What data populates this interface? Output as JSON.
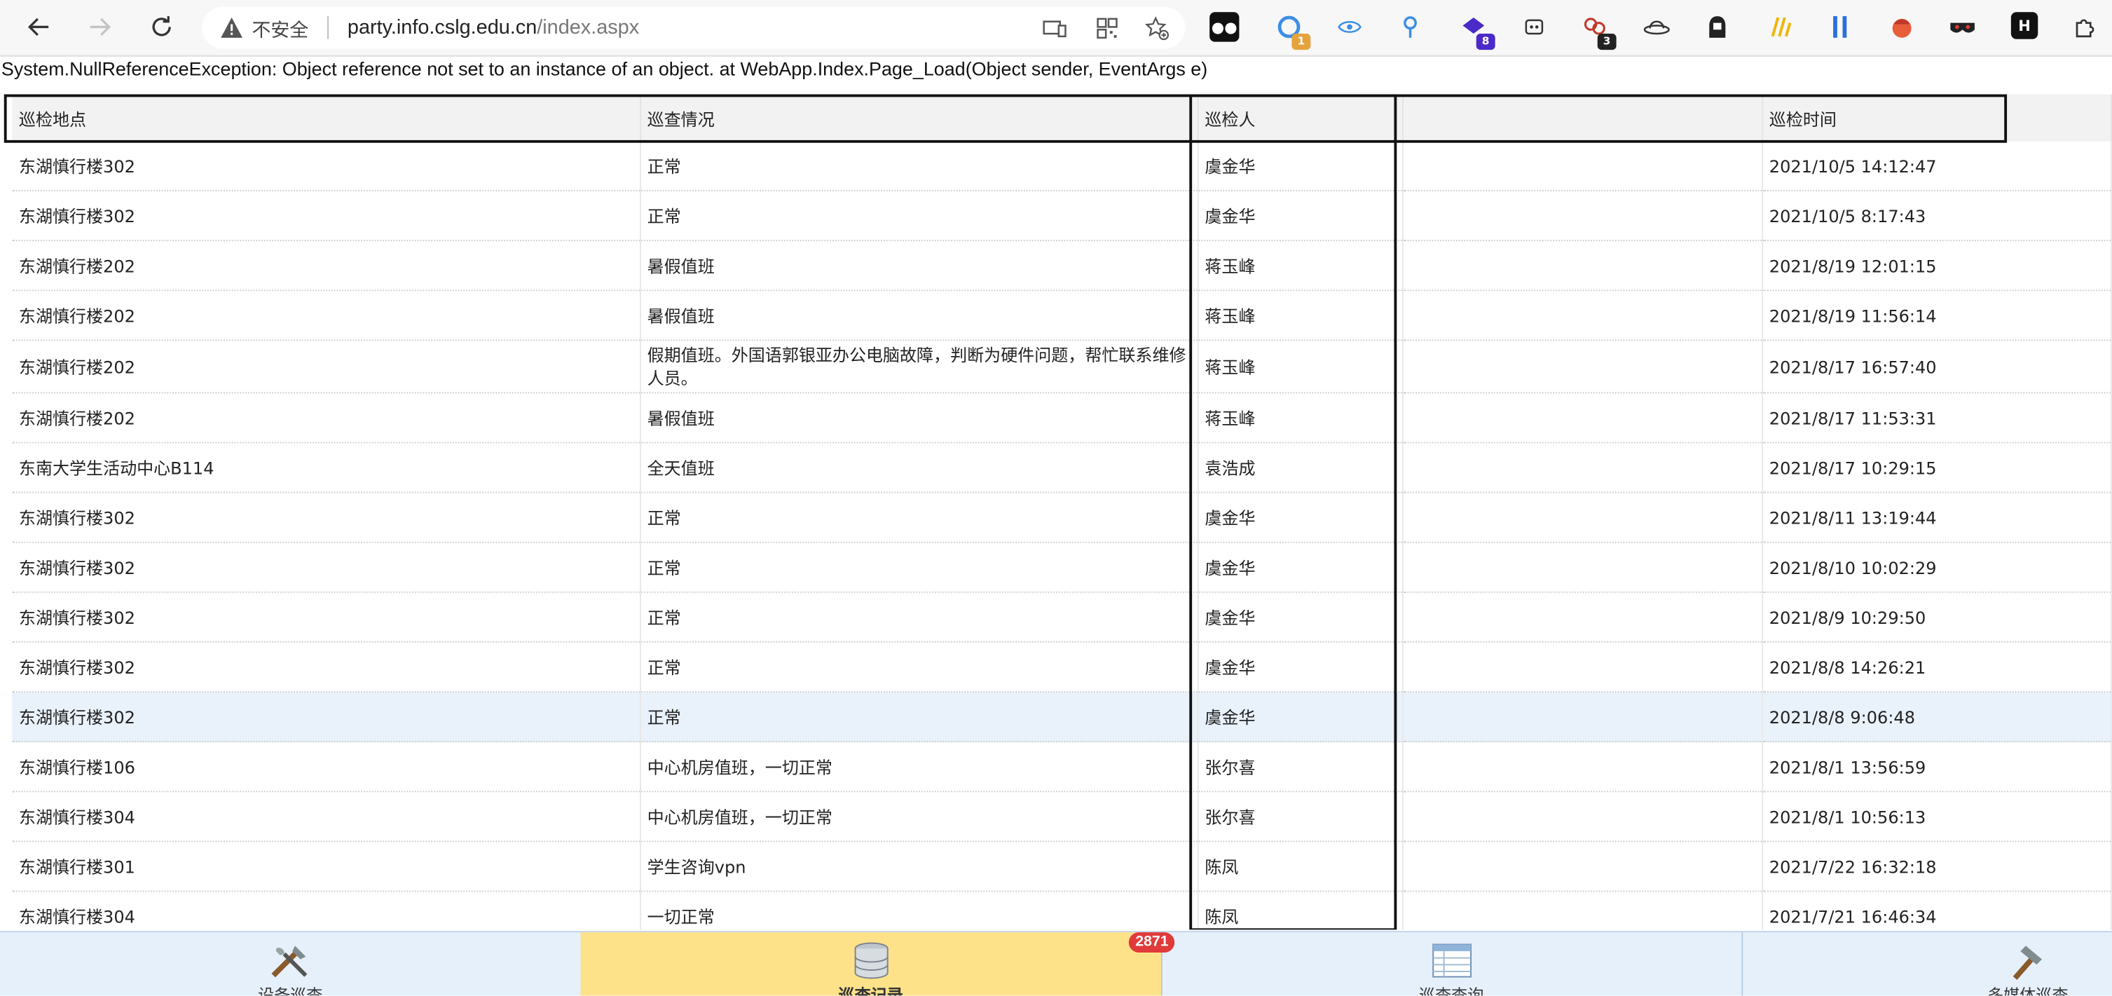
{
  "browser": {
    "security_label": "不安全",
    "url_host": "party.info.cslg.edu.cn",
    "url_path": "/index.aspx"
  },
  "error_message": "System.NullReferenceException: Object reference not set to an instance of an object. at WebApp.Index.Page_Load(Object sender, EventArgs e)",
  "table": {
    "headers": [
      "巡检地点",
      "巡查情况",
      "巡检人",
      "",
      "巡检时间"
    ],
    "rows": [
      [
        "东湖慎行楼302",
        "正常",
        "虞金华",
        "",
        "2021/10/5 14:12:47"
      ],
      [
        "东湖慎行楼302",
        "正常",
        "虞金华",
        "",
        "2021/10/5 8:17:43"
      ],
      [
        "东湖慎行楼202",
        "暑假值班",
        "蒋玉峰",
        "",
        "2021/8/19 12:01:15"
      ],
      [
        "东湖慎行楼202",
        "暑假值班",
        "蒋玉峰",
        "",
        "2021/8/19 11:56:14"
      ],
      [
        "东湖慎行楼202",
        "假期值班。外国语郭银亚办公电脑故障，判断为硬件问题，帮忙联系维修人员。",
        "蒋玉峰",
        "",
        "2021/8/17 16:57:40"
      ],
      [
        "东湖慎行楼202",
        "暑假值班",
        "蒋玉峰",
        "",
        "2021/8/17 11:53:31"
      ],
      [
        "东南大学生活动中心B114",
        "全天值班",
        "袁浩成",
        "",
        "2021/8/17 10:29:15"
      ],
      [
        "东湖慎行楼302",
        "正常",
        "虞金华",
        "",
        "2021/8/11 13:19:44"
      ],
      [
        "东湖慎行楼302",
        "正常",
        "虞金华",
        "",
        "2021/8/10 10:02:29"
      ],
      [
        "东湖慎行楼302",
        "正常",
        "虞金华",
        "",
        "2021/8/9 10:29:50"
      ],
      [
        "东湖慎行楼302",
        "正常",
        "虞金华",
        "",
        "2021/8/8 14:26:21"
      ],
      [
        "东湖慎行楼302",
        "正常",
        "虞金华",
        "",
        "2021/8/8 9:06:48"
      ],
      [
        "东湖慎行楼106",
        "中心机房值班，一切正常",
        "张尔喜",
        "",
        "2021/8/1 13:56:59"
      ],
      [
        "东湖慎行楼304",
        "中心机房值班，一切正常",
        "张尔喜",
        "",
        "2021/8/1 10:56:13"
      ],
      [
        "东湖慎行楼301",
        "学生咨询vpn",
        "陈凤",
        "",
        "2021/7/22 16:32:18"
      ],
      [
        "东湖慎行楼304",
        "一切正常",
        "陈凤",
        "",
        "2021/7/21 16:46:34"
      ]
    ],
    "highlighted_row": 11
  },
  "tabs": {
    "items": [
      {
        "label": "设备巡查",
        "icon": "tools-icon"
      },
      {
        "label": "巡查记录",
        "icon": "database-icon",
        "active": true
      },
      {
        "label": "巡查查询",
        "icon": "table-icon"
      },
      {
        "label": "多媒体巡查",
        "icon": "hammer-icon"
      }
    ],
    "badge": "2871"
  },
  "colors": {
    "active_tab": "#fde28a",
    "tabbar": "#e6f0fb",
    "badge": "#e03a3a",
    "highlight_row": "#e9f1fb"
  }
}
